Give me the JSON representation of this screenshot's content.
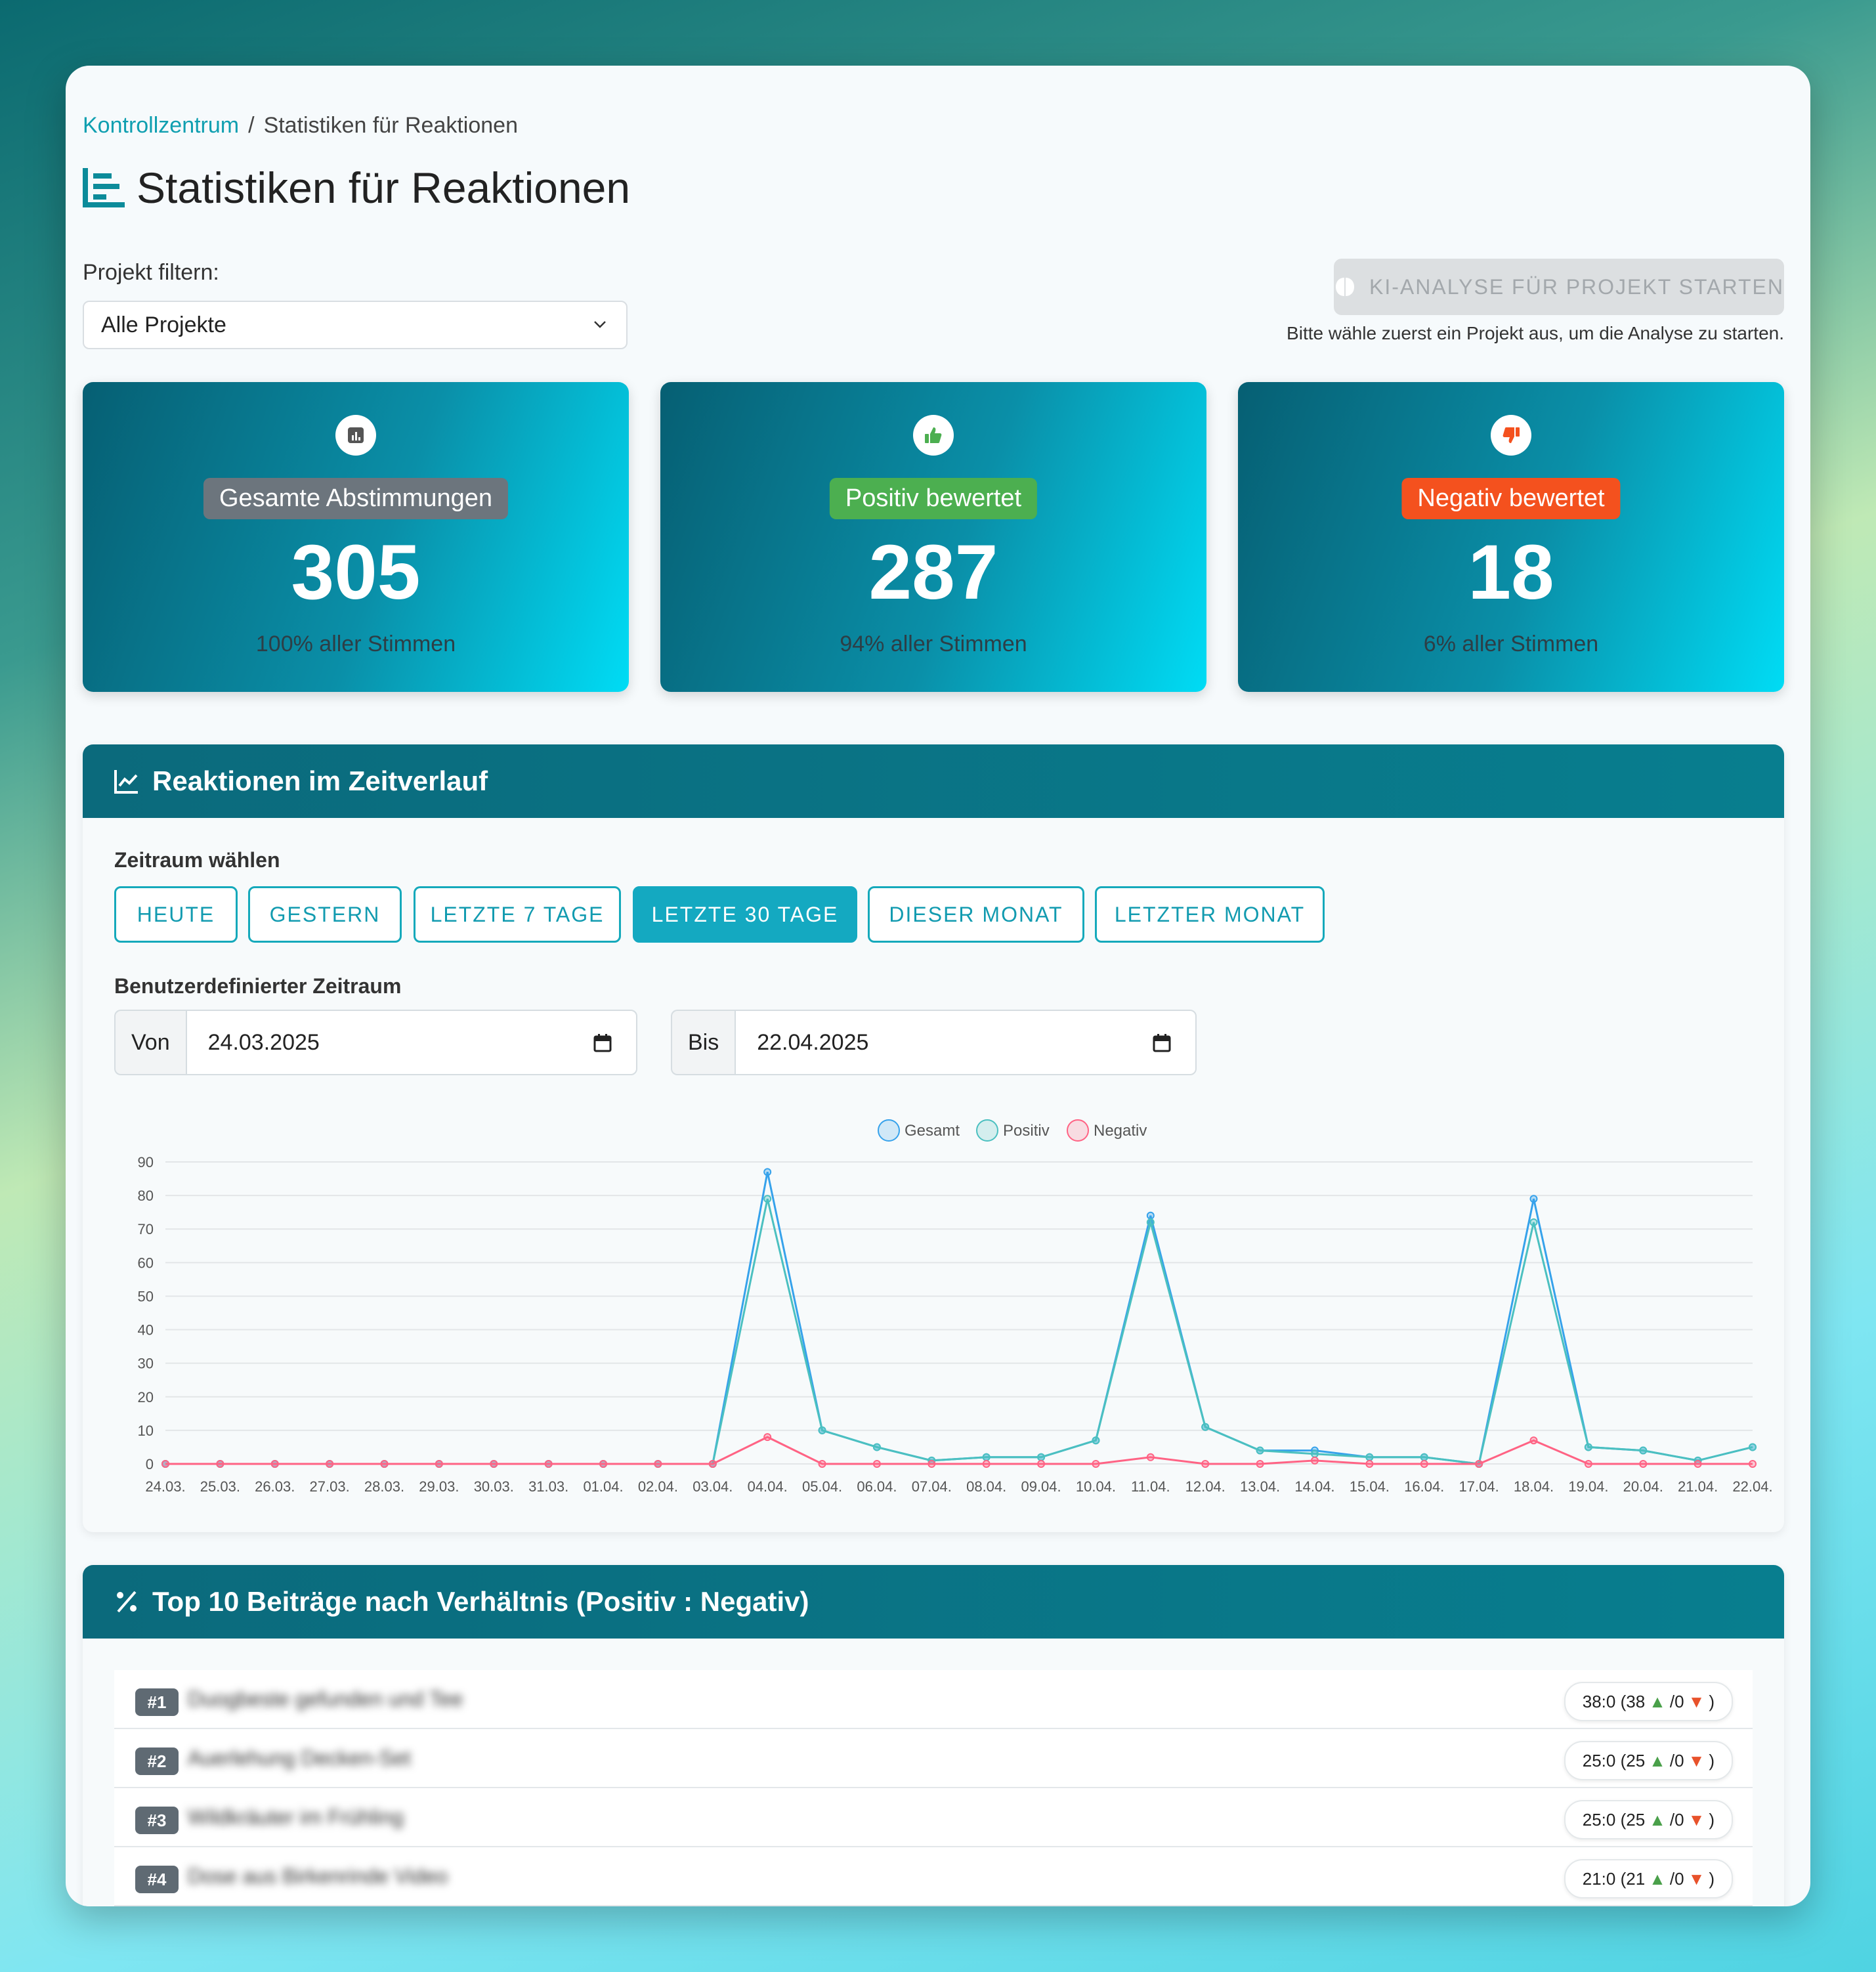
{
  "breadcrumb": {
    "root": "Kontrollzentrum",
    "separator": "/",
    "current": "Statistiken für Reaktionen"
  },
  "page_title": "Statistiken für Reaktionen",
  "filter": {
    "label": "Projekt filtern:",
    "selected": "Alle Projekte"
  },
  "ai": {
    "button_label": "KI-ANALYSE FÜR PROJEKT STARTEN",
    "hint": "Bitte wähle zuerst ein Projekt aus, um die Analyse zu starten."
  },
  "stats": [
    {
      "badge": "Gesamte Abstimmungen",
      "value": "305",
      "sub": "100% aller Stimmen",
      "badge_color": "#6c757d",
      "icon": "bar-chart-icon"
    },
    {
      "badge": "Positiv bewertet",
      "value": "287",
      "sub": "94% aller Stimmen",
      "badge_color": "#4caf50",
      "icon": "thumbs-up-icon"
    },
    {
      "badge": "Negativ bewertet",
      "value": "18",
      "sub": "6% aller Stimmen",
      "badge_color": "#f4511e",
      "icon": "thumbs-down-icon"
    }
  ],
  "timeline": {
    "title": "Reaktionen im Zeitverlauf",
    "range_label": "Zeitraum wählen",
    "ranges": [
      "HEUTE",
      "GESTERN",
      "LETZTE 7 TAGE",
      "LETZTE 30 TAGE",
      "DIESER MONAT",
      "LETZTER MONAT"
    ],
    "active_range": "LETZTE 30 TAGE",
    "custom_label": "Benutzerdefinierter Zeitraum",
    "from_label": "Von",
    "from_value": "24.03.2025",
    "to_label": "Bis",
    "to_value": "22.04.2025"
  },
  "chart_data": {
    "type": "line",
    "categories": [
      "24.03.",
      "25.03.",
      "26.03.",
      "27.03.",
      "28.03.",
      "29.03.",
      "30.03.",
      "31.03.",
      "01.04.",
      "02.04.",
      "03.04.",
      "04.04.",
      "05.04.",
      "06.04.",
      "07.04.",
      "08.04.",
      "09.04.",
      "10.04.",
      "11.04.",
      "12.04.",
      "13.04.",
      "14.04.",
      "15.04.",
      "16.04.",
      "17.04.",
      "18.04.",
      "19.04.",
      "20.04.",
      "21.04.",
      "22.04."
    ],
    "series": [
      {
        "name": "Gesamt",
        "color": "#36a2eb",
        "values": [
          0,
          0,
          0,
          0,
          0,
          0,
          0,
          0,
          0,
          0,
          0,
          87,
          10,
          5,
          1,
          2,
          2,
          7,
          74,
          11,
          4,
          4,
          2,
          2,
          0,
          79,
          5,
          4,
          1,
          5
        ]
      },
      {
        "name": "Positiv",
        "color": "#4bc0c0",
        "values": [
          0,
          0,
          0,
          0,
          0,
          0,
          0,
          0,
          0,
          0,
          0,
          79,
          10,
          5,
          1,
          2,
          2,
          7,
          72,
          11,
          4,
          3,
          2,
          2,
          0,
          72,
          5,
          4,
          1,
          5
        ]
      },
      {
        "name": "Negativ",
        "color": "#ff6384",
        "values": [
          0,
          0,
          0,
          0,
          0,
          0,
          0,
          0,
          0,
          0,
          0,
          8,
          0,
          0,
          0,
          0,
          0,
          0,
          2,
          0,
          0,
          1,
          0,
          0,
          0,
          7,
          0,
          0,
          0,
          0
        ]
      }
    ],
    "ylim": [
      0,
      90
    ],
    "yticks": [
      0,
      10,
      20,
      30,
      40,
      50,
      60,
      70,
      80,
      90
    ],
    "grid": true,
    "legend": "top-center"
  },
  "top": {
    "title": "Top 10 Beiträge nach Verhältnis (Positiv : Negativ)",
    "items": [
      {
        "rank": "#1",
        "title": "Duogbeste gefunden und Tee",
        "ratio": "38:0",
        "pos": "38",
        "neg": "0"
      },
      {
        "rank": "#2",
        "title": "Auerlehung Decken-Set",
        "ratio": "25:0",
        "pos": "25",
        "neg": "0"
      },
      {
        "rank": "#3",
        "title": "Wildkräuter im Frühling",
        "ratio": "25:0",
        "pos": "25",
        "neg": "0"
      },
      {
        "rank": "#4",
        "title": "Dose aus Birkenrinde Video",
        "ratio": "21:0",
        "pos": "21",
        "neg": "0"
      }
    ]
  }
}
